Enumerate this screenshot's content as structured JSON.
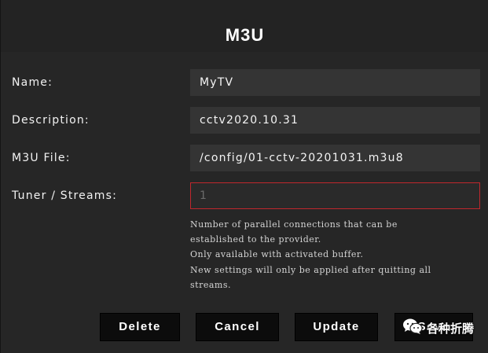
{
  "dialog": {
    "title": "M3U",
    "fields": [
      {
        "label": "Name:",
        "value": "MyTV"
      },
      {
        "label": "Description:",
        "value": "cctv2020.10.31"
      },
      {
        "label": "M3U File:",
        "value": "/config/01-cctv-20201031.m3u8"
      },
      {
        "label": "Tuner / Streams:",
        "value": "1"
      }
    ],
    "hint_lines": [
      "Number of parallel connections that can be",
      "established to the provider.",
      "Only available with activated buffer.",
      "New settings will only be applied after quitting all",
      "streams."
    ],
    "buttons": {
      "delete": "Delete",
      "cancel": "Cancel",
      "update": "Update",
      "save": "Save"
    }
  },
  "watermark": {
    "text": "各种折腾",
    "icon": "wechat-icon"
  },
  "colors": {
    "background": "#232323",
    "field": "#343434",
    "error_border": "#c0272d",
    "button": "#0c0c0c"
  }
}
